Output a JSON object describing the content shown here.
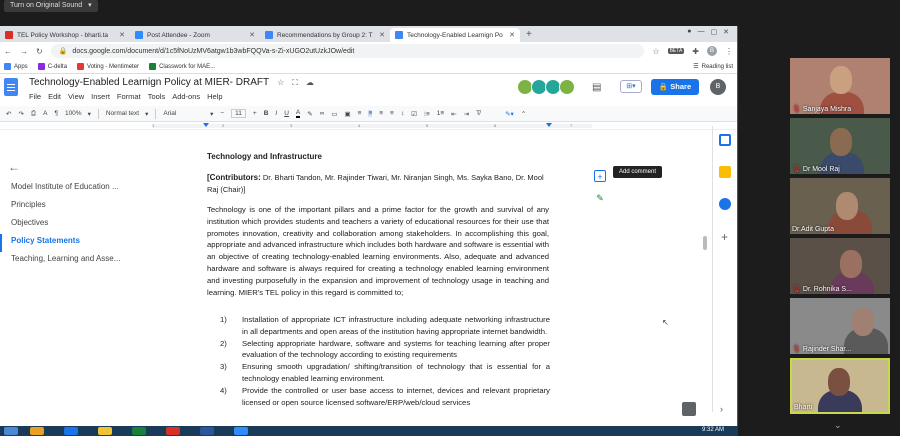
{
  "zoom": {
    "sound_button": "Turn on Original Sound"
  },
  "browser": {
    "tabs": [
      {
        "label": "TEL Policy Workshop - bharti.ta",
        "color": "#d93025"
      },
      {
        "label": "Post Attendee - Zoom",
        "color": "#2d8cff"
      },
      {
        "label": "Recommendations by Group 2: T",
        "color": "#4285f4"
      },
      {
        "label": "Technology-Enabled Learnign Po",
        "color": "#4285f4"
      }
    ],
    "url": "docs.google.com/document/d/1c5fNoUzMV6atgw1b3wbFQQVa-s-Zi-xUGO2utUzkJOw/edit",
    "bookmarks": [
      "Apps",
      "C-delta",
      "Voting - Mentimeter",
      "Classwork for MAE..."
    ],
    "reading_list": "Reading list",
    "beta": "BETA",
    "account_initial": "B"
  },
  "doc": {
    "title": "Technology-Enabled Learnign Policy at MIER- DRAFT",
    "menu": [
      "File",
      "Edit",
      "View",
      "Insert",
      "Format",
      "Tools",
      "Add-ons",
      "Help"
    ],
    "share_label": "Share",
    "user_initial": "B",
    "toolbar": {
      "zoom": "100%",
      "style": "Normal text",
      "font": "Arial",
      "size": "11"
    },
    "ruler_ticks": [
      "1",
      "2",
      "3",
      "4",
      "5",
      "6",
      "7"
    ],
    "heading": "Technology and Infrastructure",
    "contrib_label": "[Contributors:",
    "contrib_names": " Dr. Bharti Tandon, Mr. Rajinder Tiwari, Mr. Niranjan Singh, Ms. Sayka Bano, Dr. Mool Raj (Chair)]",
    "body": "Technology is one of the important pillars and a prime factor for the growth and survival of any institution which provides students and teachers a variety of educational resources for their use that promotes innovation, creativity and collaboration among stakeholders. In accomplishing this goal, appropriate and advanced infrastructure which includes both hardware and software is essential with an objective of creating technology-enabled learning environments. Also, adequate and advanced hardware and software is always required for creating a technology enabled learning environment and investing purposefully in the expansion and improvement of technology usage in teaching and learning. MIER's TEL policy in this regard is committed to;",
    "list": [
      {
        "n": "1)",
        "text": "Installation of appropriate ICT infrastructure including adequate networking infrastructure in all departments and open areas of the institution having appropriate internet bandwidth."
      },
      {
        "n": "2)",
        "text": "Selecting appropriate hardware, software and systems for teaching learning after proper evaluation of the technology according to existing requirements"
      },
      {
        "n": "3)",
        "text": "Ensuring smooth upgradation/ shifting/transition   of   technology that is essential for a technology enabled learning environment."
      },
      {
        "n": "4)",
        "text": "Provide the controlled or user base access to internet, devices and relevant proprietary licensed or open source licensed software/ERP/web/cloud services"
      }
    ],
    "tooltip": "Add comment"
  },
  "outline": {
    "items": [
      "Model Institute of Education ...",
      "Principles",
      "Objectives",
      "Policy Statements",
      "Teaching, Learning and Asse..."
    ],
    "active_index": 3
  },
  "participants": [
    {
      "name": "Sanjaya Mishra",
      "bg": "#b08070",
      "mic_muted": true
    },
    {
      "name": "Dr Mool Raj",
      "bg": "#4a5a4a",
      "mic_muted": true
    },
    {
      "name": "Dr.Adit Gupta",
      "bg": "#6a6050",
      "mic_muted": false
    },
    {
      "name": "Dr. Rohnika S...",
      "bg": "#5a5048",
      "mic_muted": true
    },
    {
      "name": "Rajinder Shar...",
      "bg": "#8a8a8a",
      "mic_muted": true
    },
    {
      "name": "Bharti",
      "bg": "#c8b890",
      "mic_muted": false
    }
  ],
  "clock": "9:32 AM"
}
